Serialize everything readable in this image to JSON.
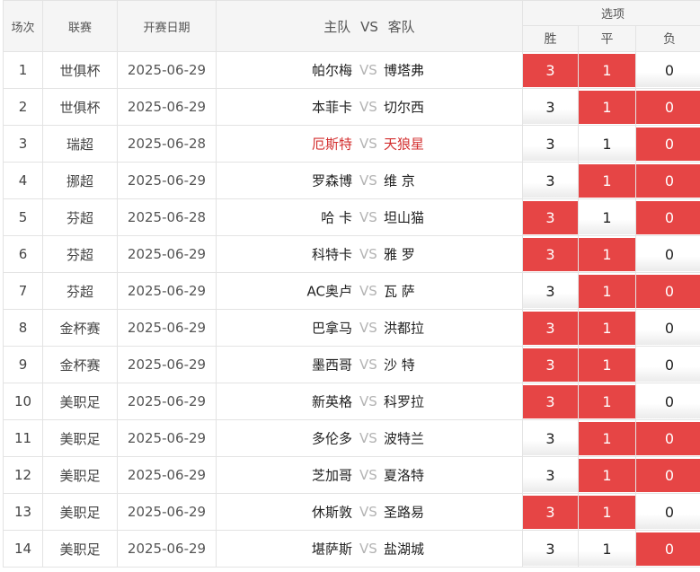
{
  "header": {
    "col_num": "场次",
    "col_league": "联赛",
    "col_date": "开赛日期",
    "col_match_home": "主队",
    "col_match_vs": "VS",
    "col_match_away": "客队",
    "col_options": "选项",
    "opt_win": "胜",
    "opt_draw": "平",
    "opt_lose": "负"
  },
  "colors": {
    "selected": "#e64545",
    "highlight_team": "#d32f2f",
    "vs_text": "#b3b3b3"
  },
  "rows": [
    {
      "num": "1",
      "league": "世俱杯",
      "date": "2025-06-29",
      "home": "帕尔梅",
      "vs": "VS",
      "away": "博塔弗",
      "win": "3",
      "draw": "1",
      "lose": "0",
      "win_sel": true,
      "draw_sel": true,
      "lose_sel": false,
      "hot": false
    },
    {
      "num": "2",
      "league": "世俱杯",
      "date": "2025-06-29",
      "home": "本菲卡",
      "vs": "VS",
      "away": "切尔西",
      "win": "3",
      "draw": "1",
      "lose": "0",
      "win_sel": false,
      "draw_sel": true,
      "lose_sel": true,
      "hot": false
    },
    {
      "num": "3",
      "league": "瑞超",
      "date": "2025-06-28",
      "home": "厄斯特",
      "vs": "VS",
      "away": "天狼星",
      "win": "3",
      "draw": "1",
      "lose": "0",
      "win_sel": false,
      "draw_sel": false,
      "lose_sel": true,
      "hot": true
    },
    {
      "num": "4",
      "league": "挪超",
      "date": "2025-06-29",
      "home": "罗森博",
      "vs": "VS",
      "away": "维 京",
      "win": "3",
      "draw": "1",
      "lose": "0",
      "win_sel": false,
      "draw_sel": true,
      "lose_sel": true,
      "hot": false
    },
    {
      "num": "5",
      "league": "芬超",
      "date": "2025-06-28",
      "home": "哈 卡",
      "vs": "VS",
      "away": "坦山猫",
      "win": "3",
      "draw": "1",
      "lose": "0",
      "win_sel": true,
      "draw_sel": false,
      "lose_sel": true,
      "hot": false
    },
    {
      "num": "6",
      "league": "芬超",
      "date": "2025-06-29",
      "home": "科特卡",
      "vs": "VS",
      "away": "雅 罗",
      "win": "3",
      "draw": "1",
      "lose": "0",
      "win_sel": true,
      "draw_sel": true,
      "lose_sel": false,
      "hot": false
    },
    {
      "num": "7",
      "league": "芬超",
      "date": "2025-06-29",
      "home": "AC奥卢",
      "vs": "VS",
      "away": "瓦 萨",
      "win": "3",
      "draw": "1",
      "lose": "0",
      "win_sel": false,
      "draw_sel": true,
      "lose_sel": true,
      "hot": false
    },
    {
      "num": "8",
      "league": "金杯赛",
      "date": "2025-06-29",
      "home": "巴拿马",
      "vs": "VS",
      "away": "洪都拉",
      "win": "3",
      "draw": "1",
      "lose": "0",
      "win_sel": true,
      "draw_sel": true,
      "lose_sel": false,
      "hot": false
    },
    {
      "num": "9",
      "league": "金杯赛",
      "date": "2025-06-29",
      "home": "墨西哥",
      "vs": "VS",
      "away": "沙 特",
      "win": "3",
      "draw": "1",
      "lose": "0",
      "win_sel": true,
      "draw_sel": true,
      "lose_sel": false,
      "hot": false
    },
    {
      "num": "10",
      "league": "美职足",
      "date": "2025-06-29",
      "home": "新英格",
      "vs": "VS",
      "away": "科罗拉",
      "win": "3",
      "draw": "1",
      "lose": "0",
      "win_sel": true,
      "draw_sel": true,
      "lose_sel": false,
      "hot": false
    },
    {
      "num": "11",
      "league": "美职足",
      "date": "2025-06-29",
      "home": "多伦多",
      "vs": "VS",
      "away": "波特兰",
      "win": "3",
      "draw": "1",
      "lose": "0",
      "win_sel": false,
      "draw_sel": true,
      "lose_sel": true,
      "hot": false
    },
    {
      "num": "12",
      "league": "美职足",
      "date": "2025-06-29",
      "home": "芝加哥",
      "vs": "VS",
      "away": "夏洛特",
      "win": "3",
      "draw": "1",
      "lose": "0",
      "win_sel": false,
      "draw_sel": true,
      "lose_sel": true,
      "hot": false
    },
    {
      "num": "13",
      "league": "美职足",
      "date": "2025-06-29",
      "home": "休斯敦",
      "vs": "VS",
      "away": "圣路易",
      "win": "3",
      "draw": "1",
      "lose": "0",
      "win_sel": true,
      "draw_sel": true,
      "lose_sel": false,
      "hot": false
    },
    {
      "num": "14",
      "league": "美职足",
      "date": "2025-06-29",
      "home": "堪萨斯",
      "vs": "VS",
      "away": "盐湖城",
      "win": "3",
      "draw": "1",
      "lose": "0",
      "win_sel": false,
      "draw_sel": false,
      "lose_sel": true,
      "hot": false
    }
  ]
}
